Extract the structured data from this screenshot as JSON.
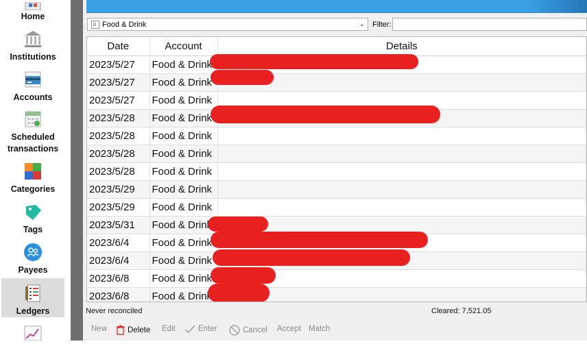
{
  "sidebar": {
    "items": [
      {
        "label": "Home",
        "icon": "home-icon"
      },
      {
        "label": "Institutions",
        "icon": "bank-icon"
      },
      {
        "label": "Accounts",
        "icon": "accounts-icon"
      },
      {
        "label": "Scheduled\ntransactions",
        "icon": "calendar-icon"
      },
      {
        "label": "Categories",
        "icon": "categories-icon"
      },
      {
        "label": "Tags",
        "icon": "tag-icon"
      },
      {
        "label": "Payees",
        "icon": "payees-icon"
      },
      {
        "label": "Ledgers",
        "icon": "ledger-icon"
      }
    ],
    "selected": "Ledgers"
  },
  "toolbar_top": {
    "account_select": "Food & Drink",
    "filter_label": "Filter:",
    "filter_value": ""
  },
  "table": {
    "columns": [
      "Date",
      "Account",
      "Details"
    ],
    "rows": [
      {
        "date": "2023/5/27",
        "account": "Food & Drink"
      },
      {
        "date": "2023/5/27",
        "account": "Food & Drink"
      },
      {
        "date": "2023/5/27",
        "account": "Food & Drink"
      },
      {
        "date": "2023/5/28",
        "account": "Food & Drink"
      },
      {
        "date": "2023/5/28",
        "account": "Food & Drink"
      },
      {
        "date": "2023/5/28",
        "account": "Food & Drink"
      },
      {
        "date": "2023/5/28",
        "account": "Food & Drink"
      },
      {
        "date": "2023/5/29",
        "account": "Food & Drink"
      },
      {
        "date": "2023/5/29",
        "account": "Food & Drink"
      },
      {
        "date": "2023/5/31",
        "account": "Food & Drink"
      },
      {
        "date": "2023/6/4",
        "account": "Food & Drink"
      },
      {
        "date": "2023/6/4",
        "account": "Food & Drink"
      },
      {
        "date": "2023/6/8",
        "account": "Food & Drink"
      },
      {
        "date": "2023/6/8",
        "account": "Food & Drink"
      }
    ]
  },
  "status": {
    "left": "Never reconciled",
    "cleared": "Cleared: 7,521.05"
  },
  "buttons": {
    "new": "New",
    "delete": "Delete",
    "edit": "Edit",
    "enter": "Enter",
    "cancel": "Cancel",
    "accept": "Accept",
    "match": "Match"
  },
  "colors": {
    "banner": "#3aa0e6",
    "redaction": "#e82020",
    "selected_nav": "#dcdcdc"
  }
}
